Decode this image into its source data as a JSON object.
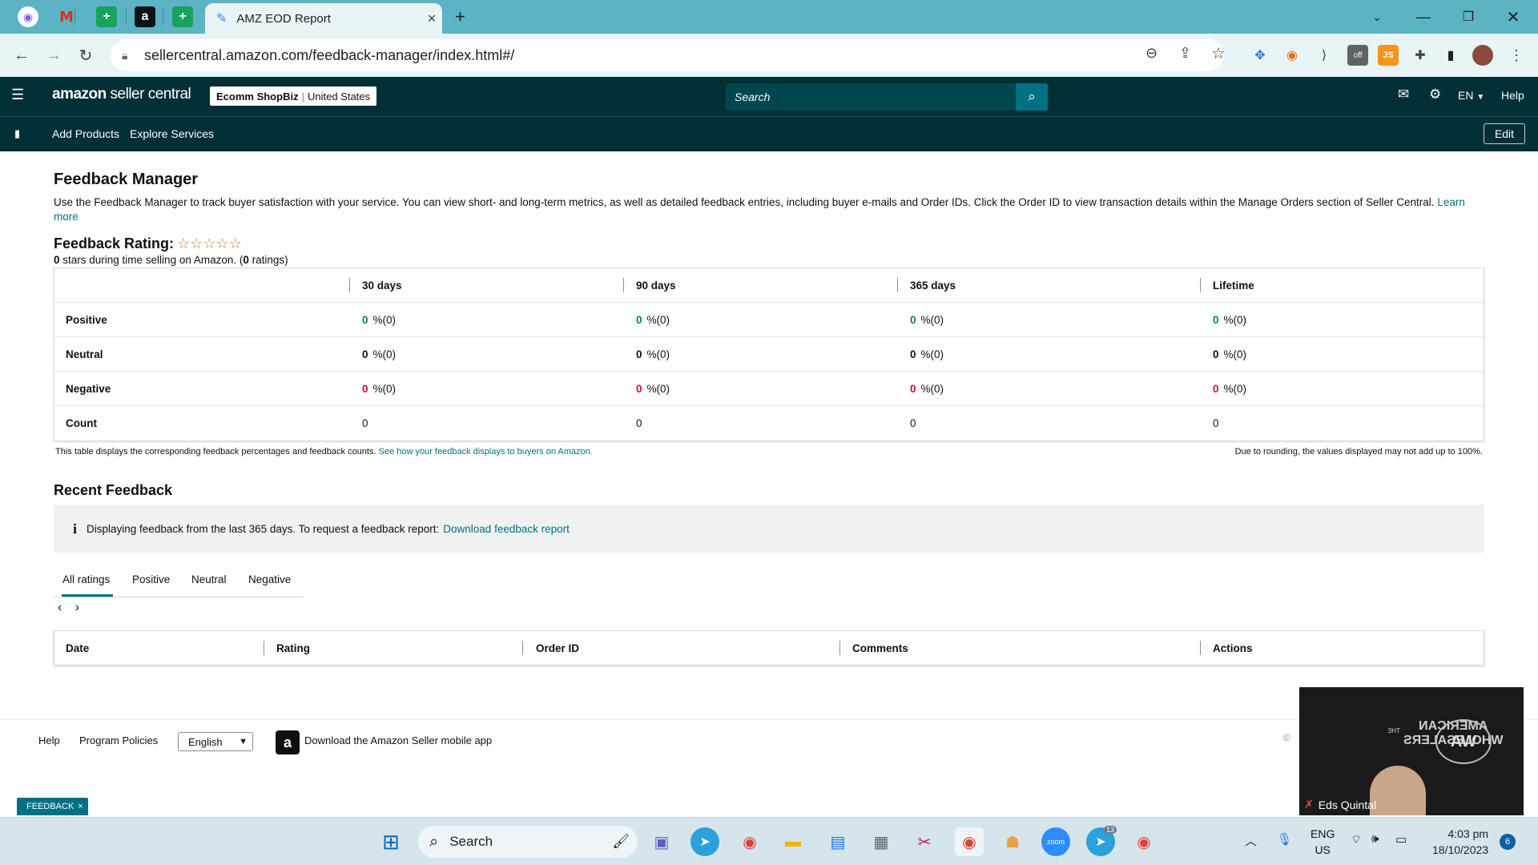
{
  "browser": {
    "active_tab_title": "AMZ EOD Report",
    "url": "sellercentral.amazon.com/feedback-manager/index.html#/"
  },
  "header": {
    "logo_brand": "amazon",
    "logo_suffix": " seller central",
    "store_name": "Ecomm ShopBiz",
    "store_region": "United States",
    "search_placeholder": "Search",
    "language": "EN",
    "help": "Help"
  },
  "subnav": {
    "items": [
      "Add Products",
      "Explore Services"
    ],
    "edit": "Edit"
  },
  "page": {
    "title": "Feedback Manager",
    "intro": "Use the Feedback Manager to track buyer satisfaction with your service. You can view short- and long-term metrics, as well as detailed feedback entries, including buyer e-mails and Order IDs. Click the Order ID to view transaction details within the Manage Orders section of Seller Central.",
    "learn_more": "Learn more",
    "rating_title": "Feedback Rating:",
    "rating_stars": 0,
    "stars_count": "0",
    "stars_text_1": " stars during time selling on Amazon. (",
    "ratings_count": "0",
    "stars_text_2": " ratings)"
  },
  "metrics": {
    "columns": [
      "30 days",
      "90 days",
      "365 days",
      "Lifetime"
    ],
    "rows": [
      {
        "label": "Positive",
        "values": [
          "0",
          "0",
          "0",
          "0"
        ],
        "suffix": "%(0)"
      },
      {
        "label": "Neutral",
        "values": [
          "0",
          "0",
          "0",
          "0"
        ],
        "suffix": "%(0)"
      },
      {
        "label": "Negative",
        "values": [
          "0",
          "0",
          "0",
          "0"
        ],
        "suffix": "%(0)"
      },
      {
        "label": "Count",
        "values": [
          "0",
          "0",
          "0",
          "0"
        ]
      }
    ],
    "note": "This table displays the corresponding feedback percentages and feedback counts.",
    "note_link": "See how your feedback displays to buyers on Amazon.",
    "rounding_note": "Due to rounding, the values displayed may not add up to 100%.",
    "colors": {
      "positive": "#067d62",
      "negative": "#cc0c39"
    }
  },
  "recent": {
    "title": "Recent Feedback",
    "info_text": "Displaying feedback from the last 365 days. To request a feedback report:",
    "info_link": "Download feedback report",
    "tabs": [
      "All ratings",
      "Positive",
      "Neutral",
      "Negative"
    ],
    "active_tab": "All ratings",
    "table_headers": [
      "Date",
      "Rating",
      "Order ID",
      "Comments",
      "Actions"
    ]
  },
  "footer": {
    "links": [
      "Help",
      "Program Policies"
    ],
    "language": "English",
    "app_text": "Download the Amazon Seller mobile app",
    "copyright_fragment": "© "
  },
  "feedback_tag": "FEEDBACK",
  "video": {
    "name": "Eds Quintal",
    "logo_line1": "AMERICAN",
    "logo_line2": "WHOLESALERS",
    "logo_small": "THE"
  },
  "taskbar": {
    "search": "Search",
    "lang_1": "ENG",
    "lang_2": "US",
    "time": "4:03 pm",
    "date": "18/10/2023",
    "notifications": "6",
    "telegram_badge": "13"
  }
}
